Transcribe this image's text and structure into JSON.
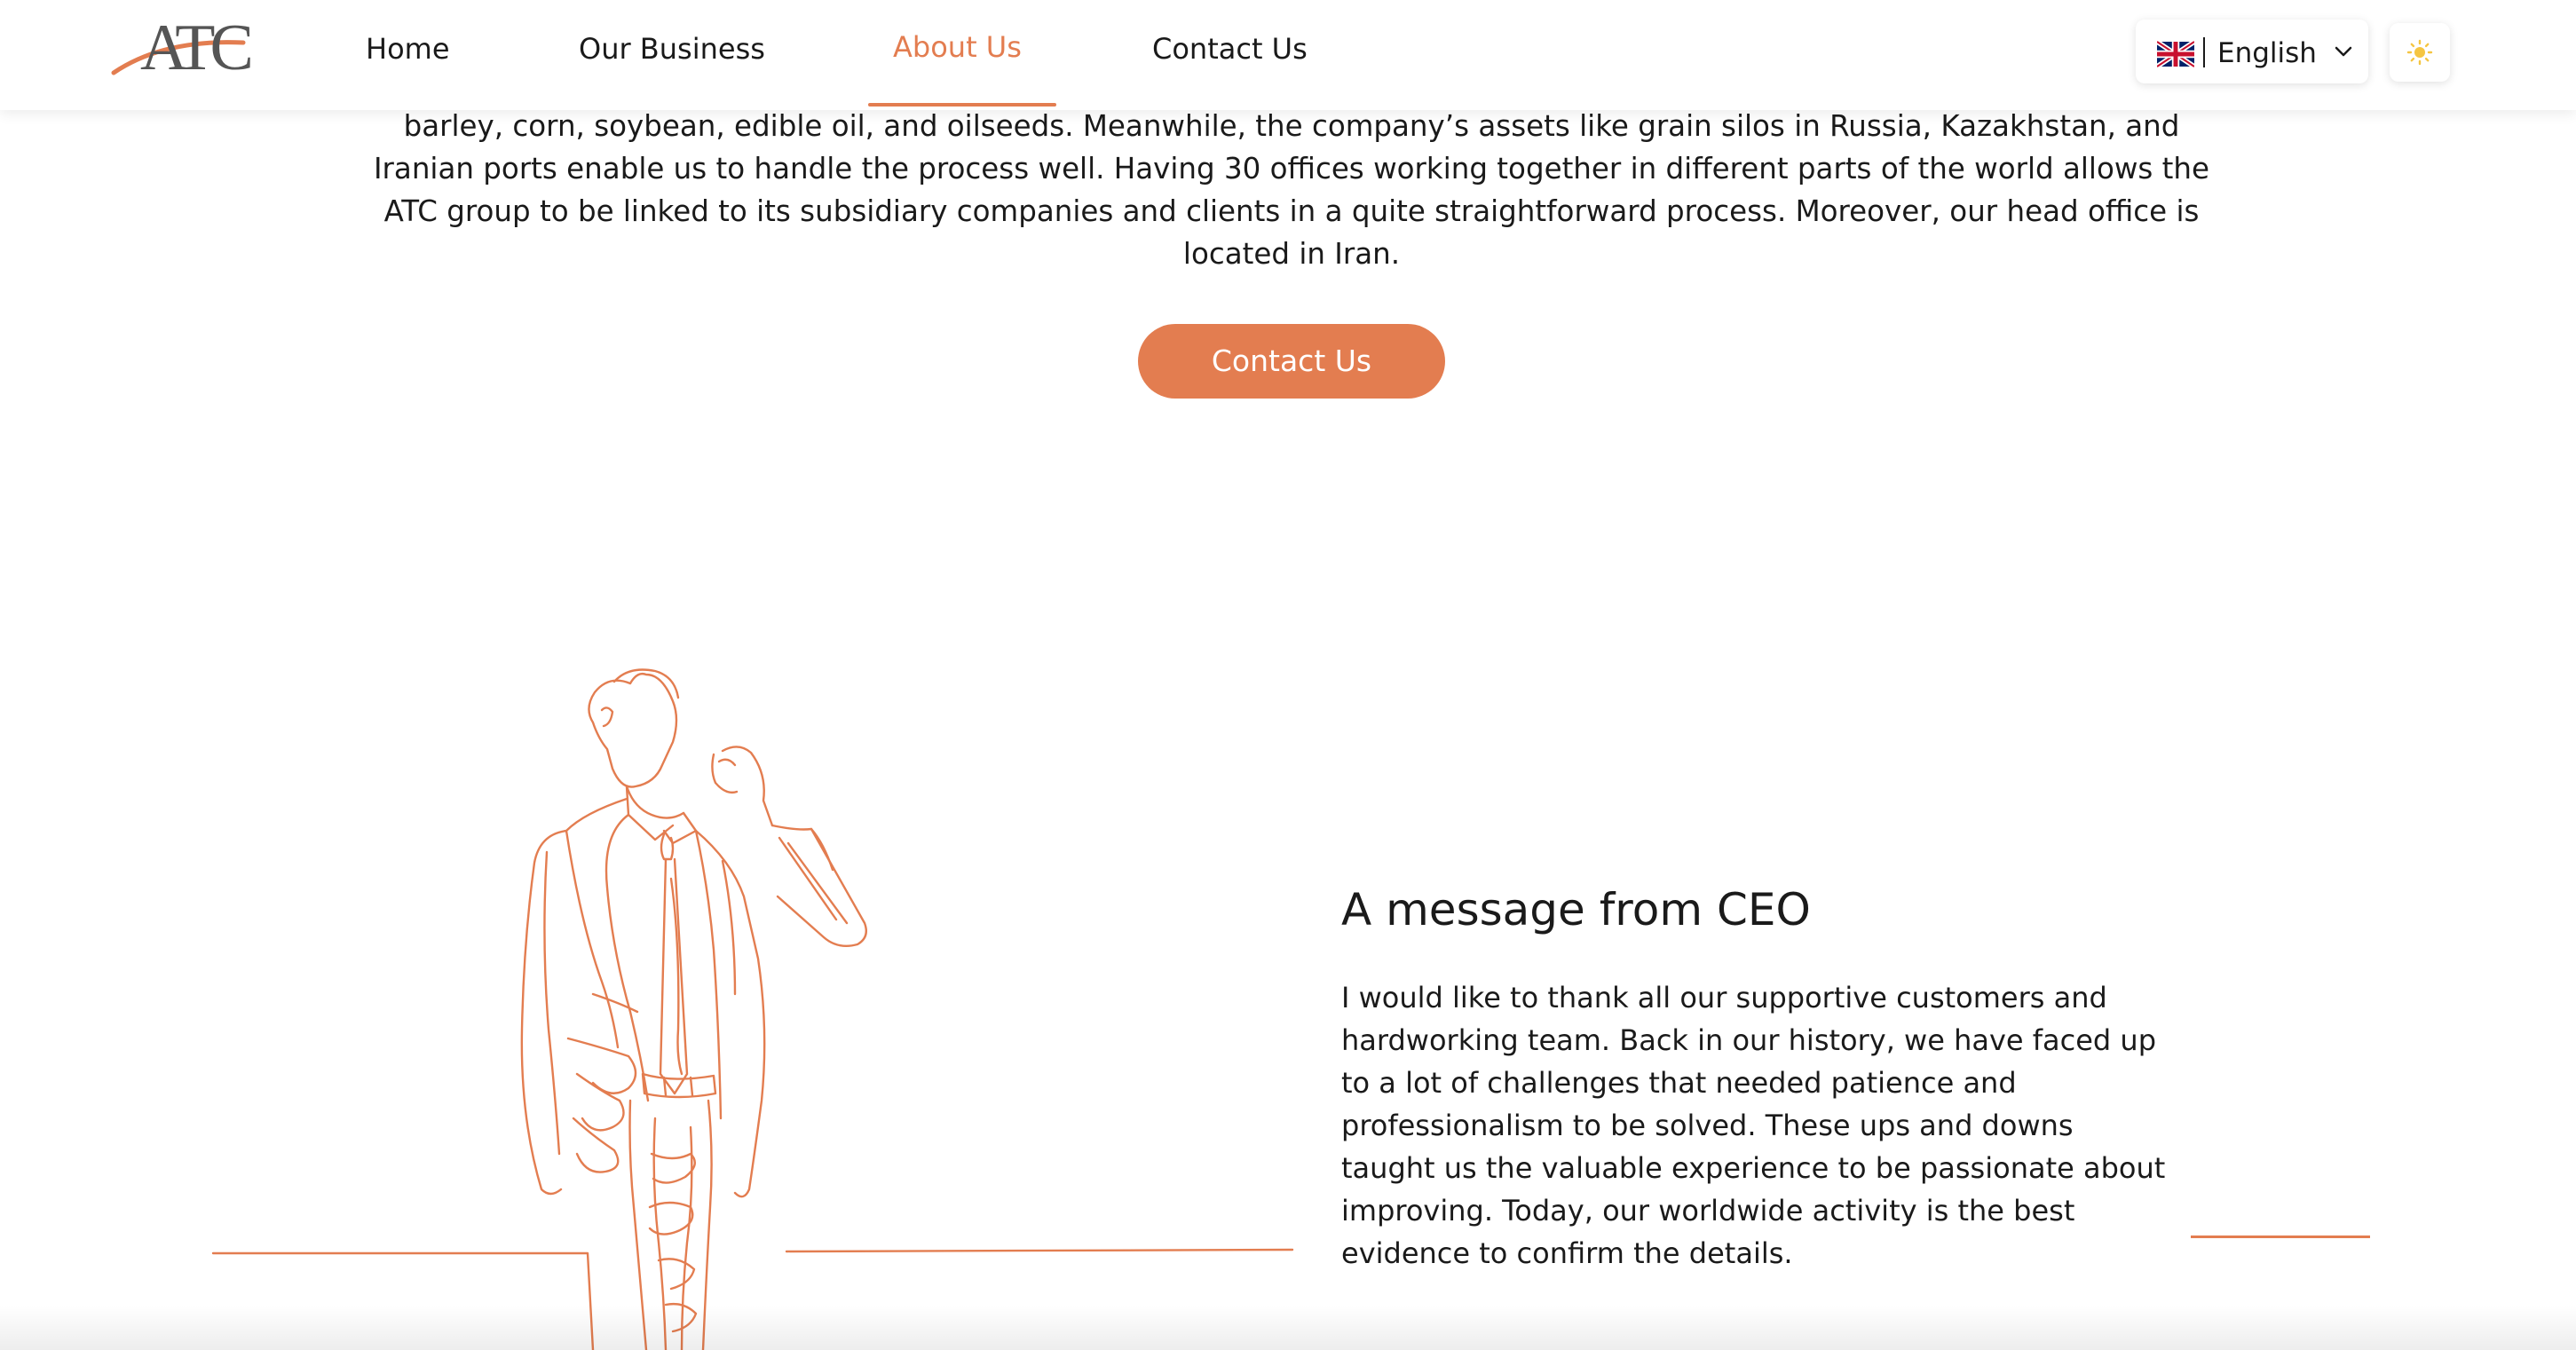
{
  "header": {
    "logo_text": "ATC",
    "nav": [
      {
        "label": "Home",
        "active": false
      },
      {
        "label": "Our Business",
        "active": false
      },
      {
        "label": "About Us",
        "active": true
      },
      {
        "label": "Contact Us",
        "active": false
      }
    ],
    "language": {
      "label": "English",
      "flag_icon": "uk-flag-icon"
    },
    "theme_toggle_icon": "sun-icon"
  },
  "intro": {
    "text": "barley, corn, soybean, edible oil, and oilseeds. Meanwhile, the company’s assets like grain silos in Russia, Kazakhstan, and Iranian ports enable us to handle the process well. Having 30 offices working together in different parts of the world allows the ATC group to be linked to its subsidiary companies and clients in a quite straightforward process. Moreover, our head office is located in Iran."
  },
  "cta": {
    "label": "Contact Us"
  },
  "ceo": {
    "title": "A message from CEO",
    "body": "I would like to thank all our supportive customers and hardworking team. Back in our history, we have faced up to a lot of challenges that needed patience and professionalism to be solved. These ups and downs taught us the valuable experience to be passionate about improving. Today, our worldwide activity is the best evidence to confirm the details."
  },
  "colors": {
    "accent": "#e37d50",
    "text": "#1a1a1a",
    "background": "#ffffff"
  }
}
